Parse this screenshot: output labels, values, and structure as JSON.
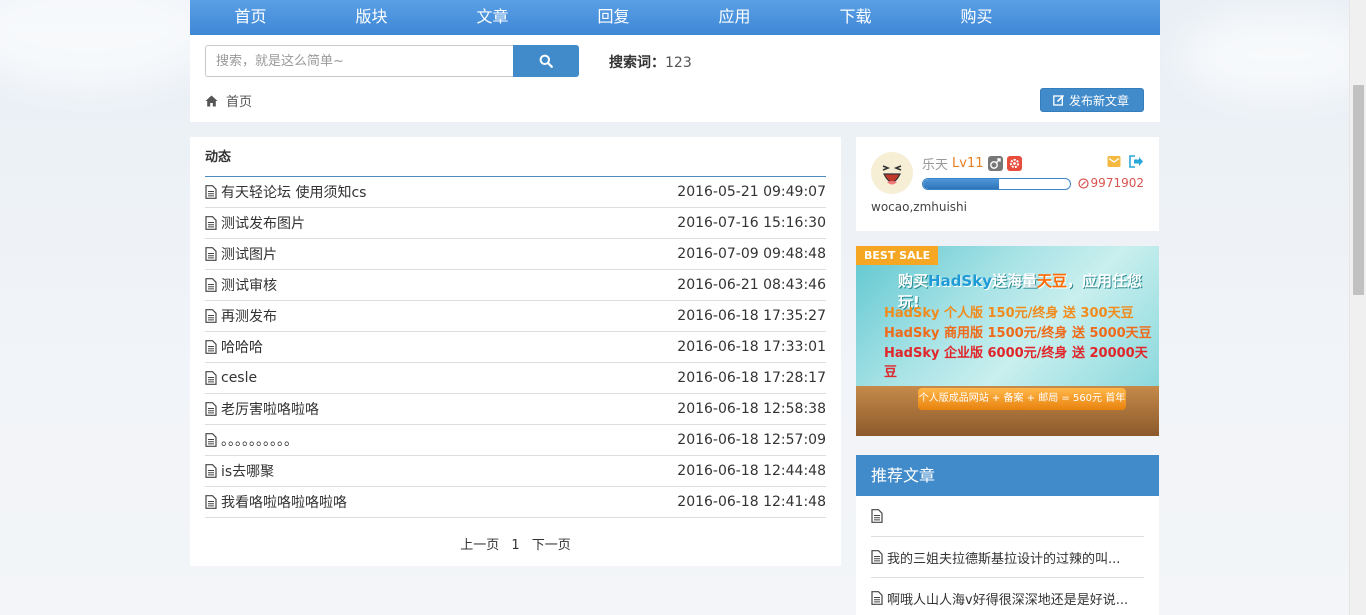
{
  "nav": [
    {
      "label": "首页"
    },
    {
      "label": "版块"
    },
    {
      "label": "文章"
    },
    {
      "label": "回复"
    },
    {
      "label": "应用"
    },
    {
      "label": "下载"
    },
    {
      "label": "购买"
    }
  ],
  "search": {
    "placeholder": "搜索，就是这么简单~",
    "words_label": "搜索词：",
    "words_value": "123"
  },
  "breadcrumb": {
    "home": "首页"
  },
  "post_button": {
    "label": "发布新文章"
  },
  "main": {
    "title": "动态",
    "items": [
      {
        "title": "有天轻论坛 使用须知cs",
        "time": "2016-05-21 09:49:07"
      },
      {
        "title": "测试发布图片",
        "time": "2016-07-16 15:16:30"
      },
      {
        "title": "测试图片",
        "time": "2016-07-09 09:48:48"
      },
      {
        "title": "测试审核",
        "time": "2016-06-21 08:43:46"
      },
      {
        "title": "再测发布",
        "time": "2016-06-18 17:35:27"
      },
      {
        "title": "哈哈哈",
        "time": "2016-06-18 17:33:01"
      },
      {
        "title": "cesle",
        "time": "2016-06-18 17:28:17"
      },
      {
        "title": "老厉害啦咯啦咯",
        "time": "2016-06-18 12:58:38"
      },
      {
        "title": "。。。。。。。。。。",
        "time": "2016-06-18 12:57:09"
      },
      {
        "title": "is去哪聚",
        "time": "2016-06-18 12:44:48"
      },
      {
        "title": "我看咯啦咯啦咯啦咯",
        "time": "2016-06-18 12:41:48"
      }
    ],
    "pager": {
      "prev": "上一页",
      "page": "1",
      "next": "下一页"
    }
  },
  "user": {
    "name": "乐天",
    "level": "Lv11",
    "points": "9971902",
    "signature": "wocao,zmhuishi",
    "progress": 0.52
  },
  "banner": {
    "tag": "BEST SALE",
    "headline_a": "购买",
    "headline_brand": "HadSky",
    "headline_b": "送海量",
    "headline_c": "天豆",
    "headline_d": "，应用任您玩!",
    "line1": "HadSky 个人版 150元/终身 送 300天豆",
    "line2": "HadSky 商用版 1500元/终身 送 5000天豆",
    "line3": "HadSky 企业版 6000元/终身 送 20000天豆",
    "pill": "个人版成品网站 + 备案 + 邮局 = 560元 首年"
  },
  "recommend": {
    "title": "推荐文章",
    "items": [
      {
        "title": ""
      },
      {
        "title": "我的三姐夫拉德斯基拉设计的过辣的叫..."
      },
      {
        "title": "啊哦人山人海v好得很深深地还是是好说..."
      }
    ]
  },
  "colors": {
    "primary": "#428bca",
    "nav": "#4a90dc",
    "accent": "#e67e22",
    "danger": "#d9534f"
  }
}
